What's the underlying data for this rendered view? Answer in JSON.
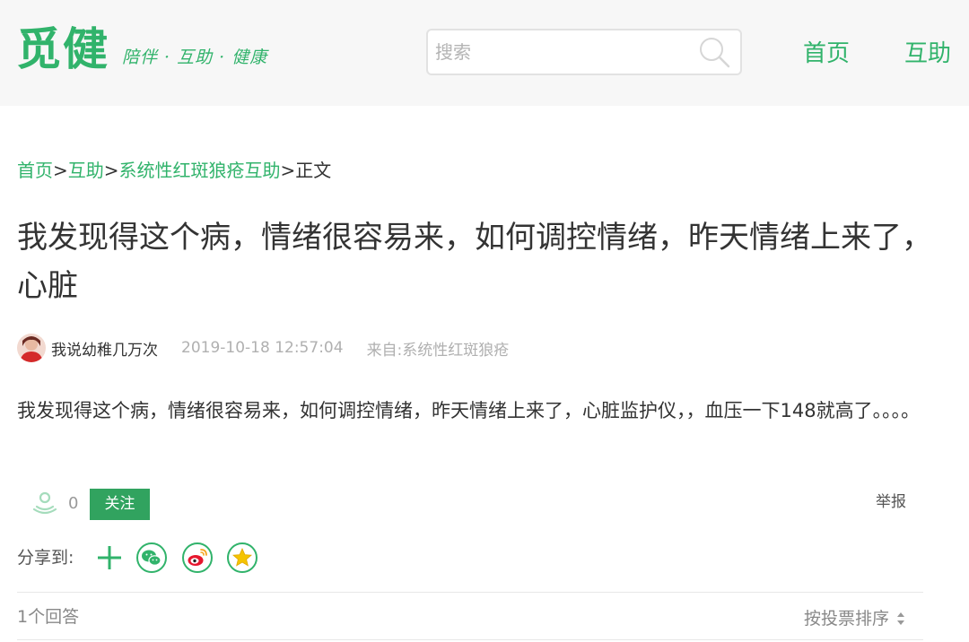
{
  "header": {
    "logo_text": "觅健",
    "slogan": "陪伴 · 互助 · 健康",
    "search": {
      "placeholder": "搜索",
      "value": ""
    },
    "nav": [
      {
        "label": "首页"
      },
      {
        "label": "互助"
      }
    ]
  },
  "breadcrumb": {
    "items": [
      "首页",
      "互助",
      "系统性红斑狼疮互助"
    ],
    "current": "正文",
    "separator": ">"
  },
  "post": {
    "title": "我发现得这个病，情绪很容易来，如何调控情绪，昨天情绪上来了，心脏",
    "author": "我说幼稚几万次",
    "time": "2019-10-18 12:57:04",
    "source_label": "来自:",
    "source": "系统性红斑狼疮",
    "content": "我发现得这个病，情绪很容易来，如何调控情绪，昨天情绪上来了，心脏监护仪，，血压一下148就高了。。。。"
  },
  "actions": {
    "like_count": "0",
    "follow_label": "关注",
    "report_label": "举报",
    "share_label": "分享到:",
    "share_targets": [
      "plus-icon",
      "wechat-icon",
      "weibo-icon",
      "qzone-icon"
    ]
  },
  "answers": {
    "count_text": "1个回答",
    "sort_label": "按投票排序"
  },
  "colors": {
    "brand": "#31b36b",
    "button": "#31a35f",
    "header_bg": "#f7f7f7",
    "muted": "#b0b0b0"
  }
}
